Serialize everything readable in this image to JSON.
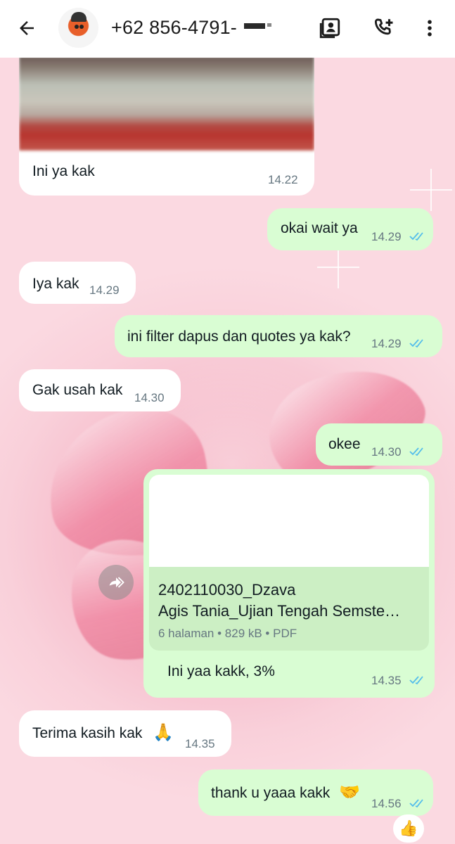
{
  "header": {
    "back_icon": "arrow-left-icon",
    "contact_name": "+62 856-4791-",
    "icons": [
      "contact-card-icon",
      "add-call-icon",
      "more-vertical-icon"
    ]
  },
  "colors": {
    "incoming_bubble": "#ffffff",
    "outgoing_bubble": "#d9fdd3",
    "read_ticks": "#53bdeb",
    "timestamp": "#667781"
  },
  "messages": [
    {
      "direction": "in",
      "type": "image",
      "text": "Ini ya kak",
      "time": "14.22"
    },
    {
      "direction": "out",
      "text": "okai wait ya",
      "time": "14.29",
      "status": "read"
    },
    {
      "direction": "in",
      "text": "Iya kak",
      "time": "14.29"
    },
    {
      "direction": "out",
      "text": "ini filter dapus dan quotes ya kak?",
      "time": "14.29",
      "status": "read"
    },
    {
      "direction": "in",
      "text": "Gak usah kak",
      "time": "14.30"
    },
    {
      "direction": "out",
      "text": "okee",
      "time": "14.30",
      "status": "read"
    },
    {
      "direction": "out",
      "type": "document",
      "doc_name_line1": "2402110030_Dzava",
      "doc_name_line2": "Agis Tania_Ujian Tengah Semste…",
      "doc_meta": "6 halaman • 829 kB • PDF",
      "text": "Ini yaa kakk, 3%",
      "time": "14.35",
      "status": "read"
    },
    {
      "direction": "in",
      "text": "Terima kasih kak",
      "emoji": "🙏",
      "time": "14.35"
    },
    {
      "direction": "out",
      "text": "thank u yaaa kakk",
      "emoji": "🤝",
      "time": "14.56",
      "status": "read",
      "reaction": "👍"
    }
  ]
}
